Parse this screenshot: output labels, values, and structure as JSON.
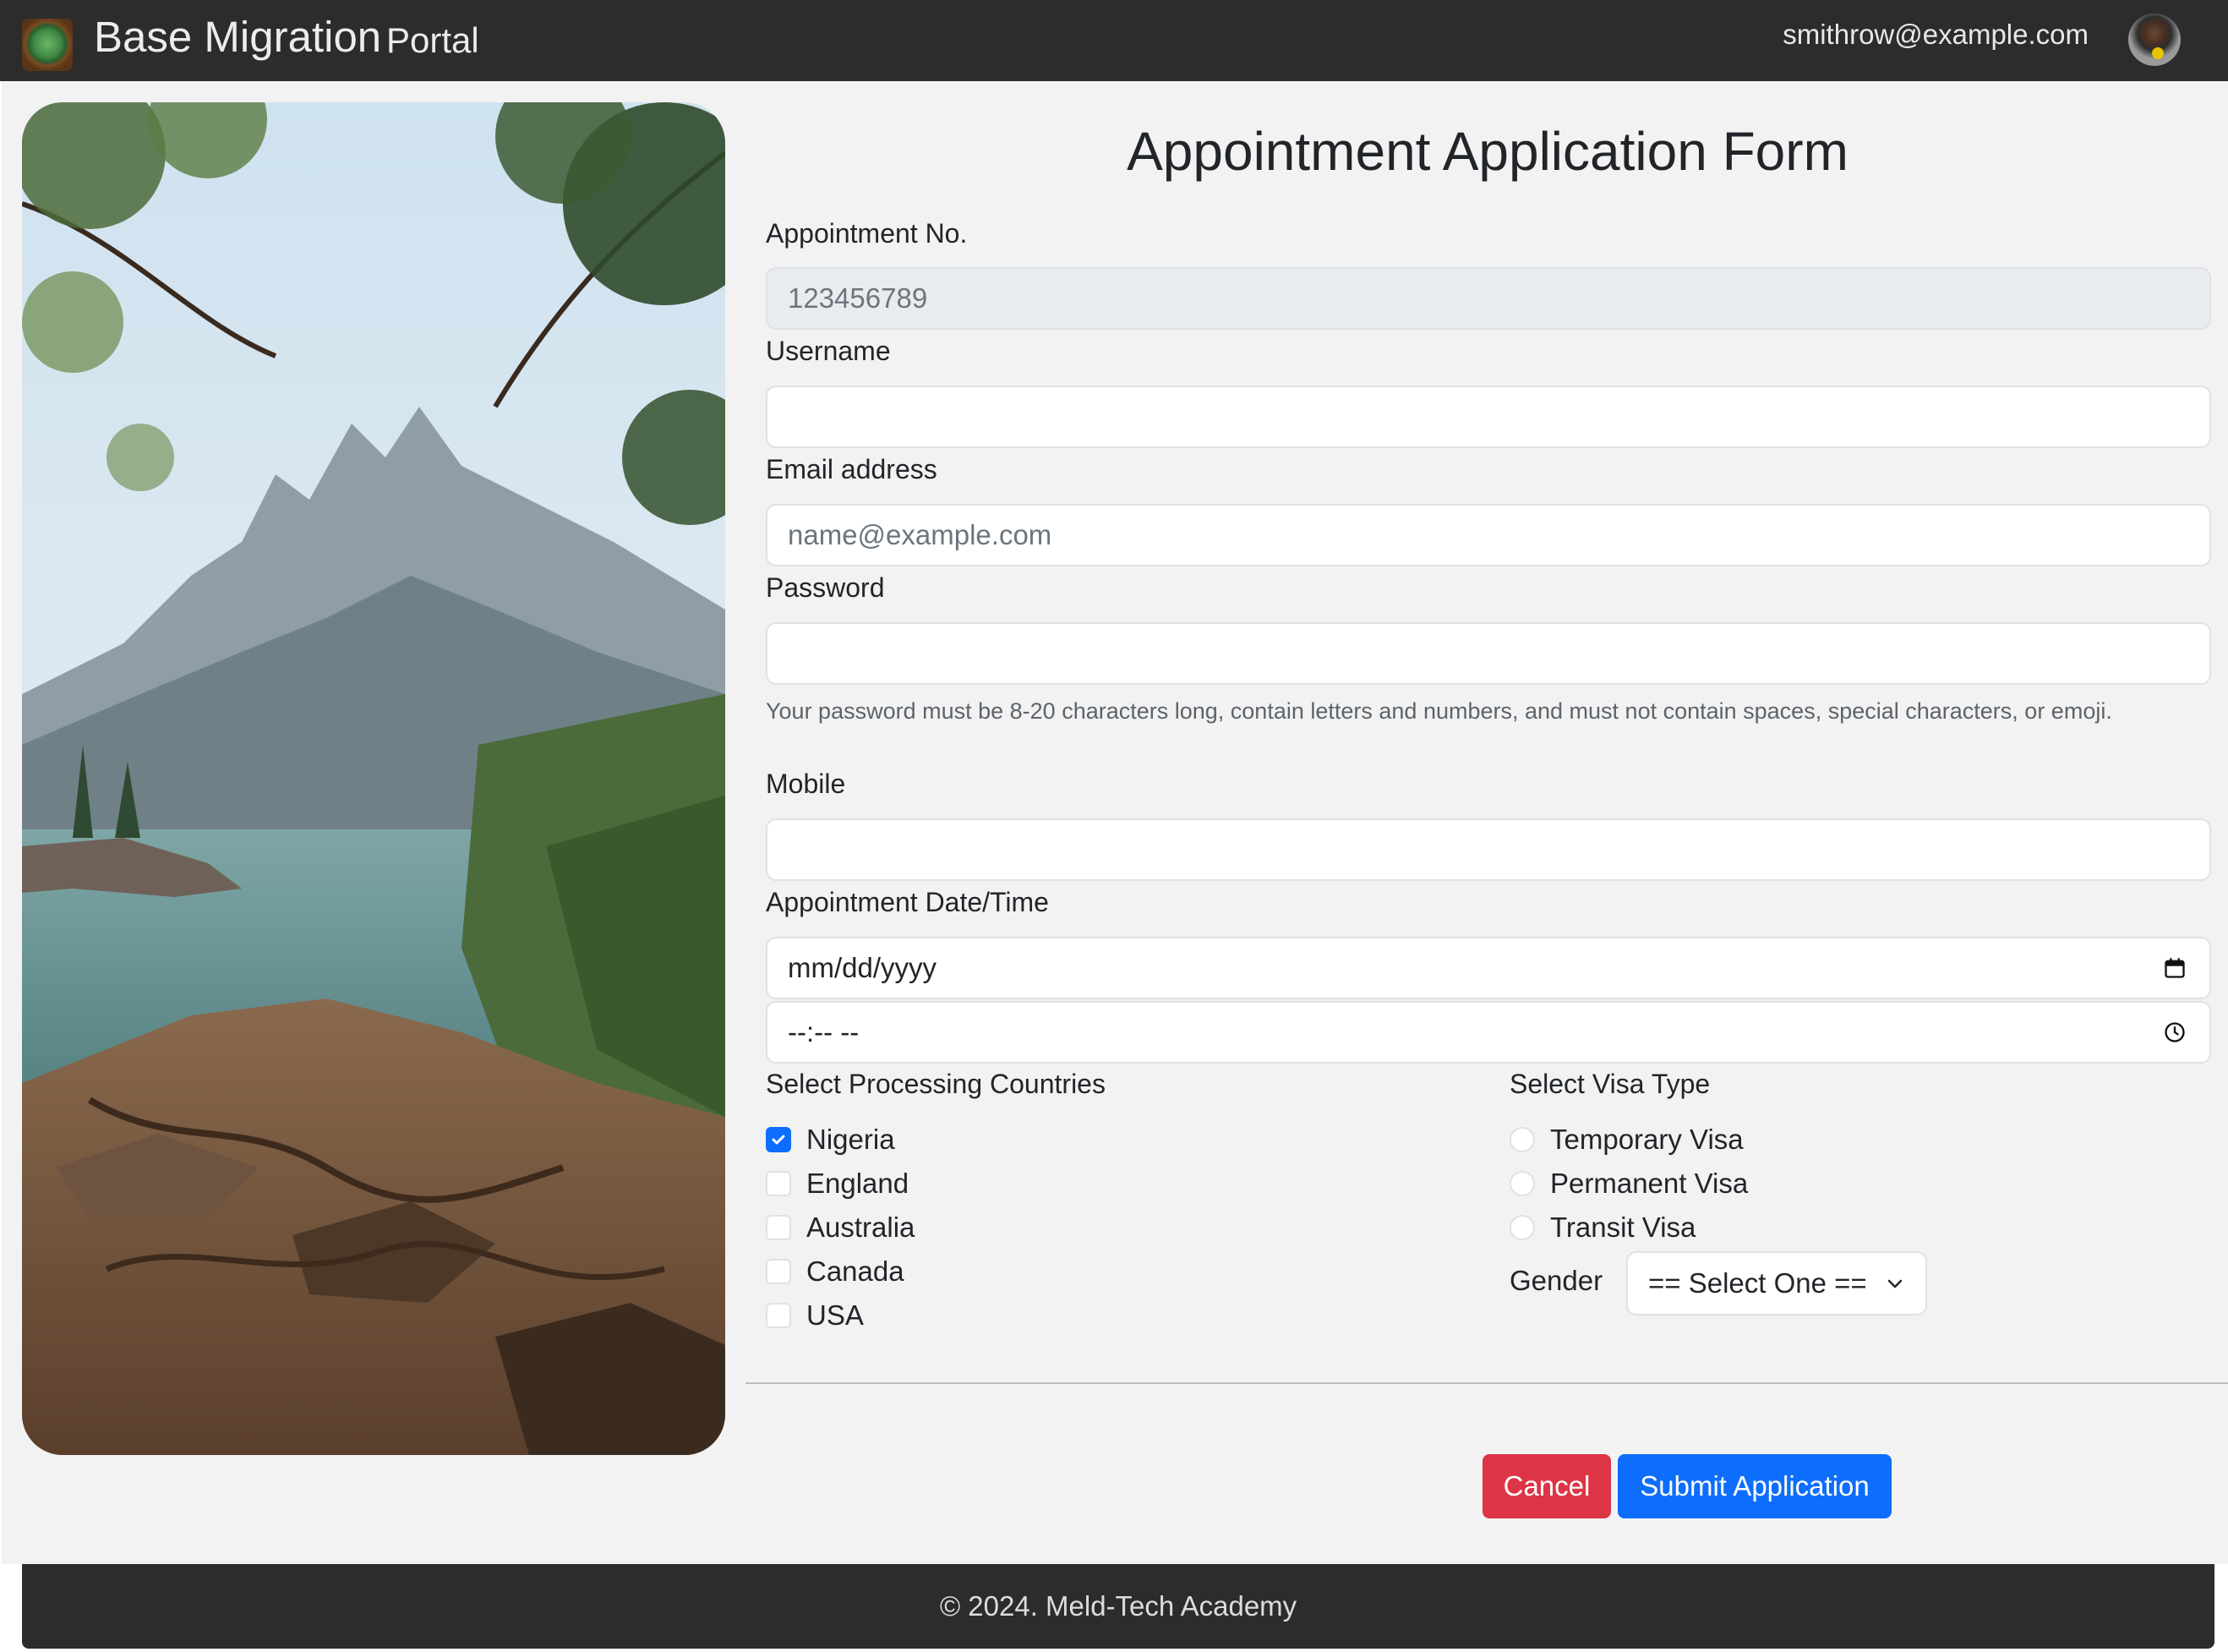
{
  "navbar": {
    "brand_title": "Base Migration",
    "brand_subtitle": "Portal",
    "user_email": "smithrow@example.com",
    "logo_icon": "globe-logo-icon",
    "avatar_icon": "user-avatar-icon"
  },
  "form": {
    "title": "Appointment Application Form",
    "appointment_no": {
      "label": "Appointment No.",
      "value": "123456789"
    },
    "username": {
      "label": "Username",
      "value": ""
    },
    "email": {
      "label": "Email address",
      "placeholder": "name@example.com"
    },
    "password": {
      "label": "Password",
      "value": "",
      "help": "Your password must be 8-20 characters long, contain letters and numbers, and must not contain spaces, special characters, or emoji."
    },
    "mobile": {
      "label": "Mobile",
      "value": ""
    },
    "datetime": {
      "label": "Appointment Date/Time",
      "date_placeholder": "mm/dd/yyyy",
      "time_placeholder": "--:-- --",
      "date_icon": "calendar-icon",
      "time_icon": "clock-icon"
    },
    "countries": {
      "label": "Select Processing Countries",
      "options": [
        {
          "label": "Nigeria",
          "checked": true
        },
        {
          "label": "England",
          "checked": false
        },
        {
          "label": "Australia",
          "checked": false
        },
        {
          "label": "Canada",
          "checked": false
        },
        {
          "label": "USA",
          "checked": false
        }
      ]
    },
    "visa": {
      "label": "Select Visa Type",
      "options": [
        {
          "label": "Temporary Visa",
          "checked": false
        },
        {
          "label": "Permanent Visa",
          "checked": false
        },
        {
          "label": "Transit Visa",
          "checked": false
        }
      ]
    },
    "gender": {
      "label": "Gender",
      "selected": "== Select One =="
    },
    "buttons": {
      "cancel": "Cancel",
      "submit": "Submit Application"
    }
  },
  "footer": {
    "text": "© 2024. Meld-Tech Academy"
  },
  "colors": {
    "navbar_bg": "#2c2c2c",
    "page_bg": "#f2f2f2",
    "primary": "#0d6efd",
    "danger": "#dc3545",
    "readonly_bg": "#e9ecef"
  }
}
